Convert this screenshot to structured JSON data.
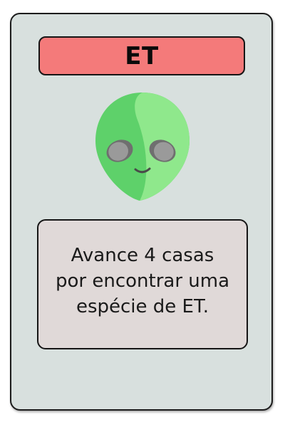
{
  "card": {
    "title": "ET",
    "icon": "alien-head-icon",
    "text": "Avance 4 casas\npor encontrar uma\nespécie de ET."
  },
  "colors": {
    "card_background": "#d8e0de",
    "title_bar": "#f47a7a",
    "text_box": "#e0d9d8",
    "alien_light": "#8fe88c",
    "alien_dark": "#5ed16a",
    "alien_eyes": "#8a8a8a"
  }
}
